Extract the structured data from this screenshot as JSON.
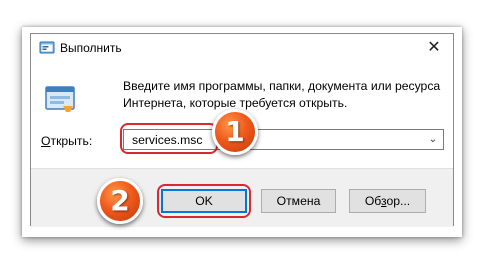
{
  "window": {
    "title": "Выполнить",
    "close_glyph": "✕",
    "title_icon": "run-app-icon"
  },
  "description": {
    "line1": "Введите имя программы, папки, документа или ресурса",
    "line2": "Интернета, которые требуется открыть."
  },
  "open_field": {
    "label_prefix": "О",
    "label_rest": "ткрыть:",
    "value": "services.msc",
    "dropdown_glyph": "⌄"
  },
  "buttons": {
    "ok": "OK",
    "cancel": "Отмена",
    "browse_prefix": "Об",
    "browse_underlined": "з",
    "browse_rest": "ор..."
  },
  "annotations": {
    "step1": "1",
    "step2": "2",
    "highlight_color": "#d9282f",
    "badge_color": "#f0591c"
  }
}
